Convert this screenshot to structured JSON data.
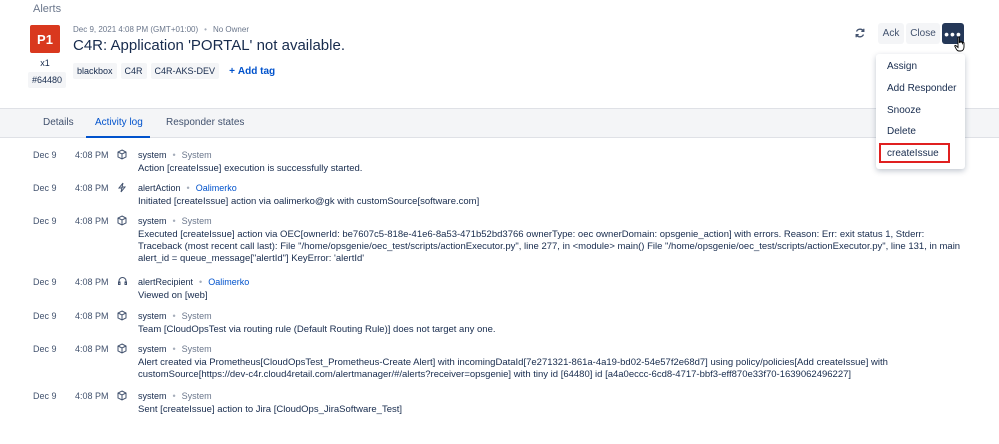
{
  "breadcrumb": "Alerts",
  "alert": {
    "priority": "P1",
    "count": "x1",
    "tiny_id": "#64480",
    "date": "Dec 9, 2021 4:08 PM (GMT+01:00)",
    "owner": "No Owner",
    "title": "C4R: Application 'PORTAL' not available.",
    "tags": [
      "blackbox",
      "C4R",
      "C4R-AKS-DEV"
    ],
    "add_tag": "Add tag"
  },
  "actions": {
    "ack": "Ack",
    "close": "Close",
    "more": "•••"
  },
  "menu": {
    "items": [
      "Assign",
      "Add Responder",
      "Snooze",
      "Delete"
    ],
    "highlighted": "createIssue"
  },
  "tabs": [
    "Details",
    "Activity log",
    "Responder states"
  ],
  "activity": [
    {
      "date": "Dec 9",
      "time": "4:08 PM",
      "icon": "cube-icon",
      "actor": "system",
      "by": "System",
      "message": "Action [createIssue] execution is successfully started."
    },
    {
      "date": "Dec 9",
      "time": "4:08 PM",
      "icon": "lightning-icon",
      "actor": "alertAction",
      "by": "Oalimerko",
      "message": "Initiated [createIssue] action via oalimerko@gk with customSource[software.com]"
    },
    {
      "date": "Dec 9",
      "time": "4:08 PM",
      "icon": "cube-icon",
      "actor": "system",
      "by": "System",
      "message": "Executed [createIssue] action via OEC[ownerId: be7607c5-818e-41e6-8a53-471b52bd3766 ownerType: oec ownerDomain: opsgenie_action] with errors. Reason: Err: exit status 1, Stderr: Traceback (most recent call last): File \"/home/opsgenie/oec_test/scripts/actionExecutor.py\", line 277, in <module> main() File \"/home/opsgenie/oec_test/scripts/actionExecutor.py\", line 131, in main alert_id = queue_message[\"alertId\"] KeyError: 'alertId'"
    },
    {
      "date": "Dec 9",
      "time": "4:08 PM",
      "icon": "headset-icon",
      "actor": "alertRecipient",
      "by": "Oalimerko",
      "message": "Viewed on [web]"
    },
    {
      "date": "Dec 9",
      "time": "4:08 PM",
      "icon": "cube-icon",
      "actor": "system",
      "by": "System",
      "message": "Team [CloudOpsTest via routing rule (Default Routing Rule)] does not target any one."
    },
    {
      "date": "Dec 9",
      "time": "4:08 PM",
      "icon": "cube-icon",
      "actor": "system",
      "by": "System",
      "message": "Alert created via Prometheus[CloudOpsTest_Prometheus-Create Alert] with incomingDataId[7e271321-861a-4a19-bd02-54e57f2e68d7] using policy/policies[Add createIssue] with customSource[https://dev-c4r.cloud4retail.com/alertmanager/#/alerts?receiver=opsgenie] with tiny id [64480] id [a4a0eccc-6cd8-4717-bbf3-eff870e33f70-1639062496227]"
    },
    {
      "date": "Dec 9",
      "time": "4:08 PM",
      "icon": "cube-icon",
      "actor": "system",
      "by": "System",
      "message": "Sent [createIssue] action to Jira [CloudOps_JiraSoftware_Test]"
    }
  ]
}
